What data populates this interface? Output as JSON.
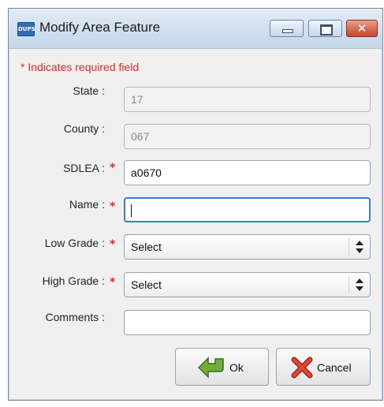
{
  "window": {
    "title": "Modify Area Feature",
    "app_icon_text": "DUPS"
  },
  "form": {
    "required_note": "* Indicates required field",
    "fields": {
      "state": {
        "label": "State :",
        "value": "17"
      },
      "county": {
        "label": "County :",
        "value": "067"
      },
      "sdlea": {
        "label": "SDLEA :",
        "value": "a0670",
        "required": true
      },
      "name": {
        "label": "Name :",
        "value": "",
        "required": true
      },
      "low_grade": {
        "label": "Low Grade :",
        "value": "Select",
        "required": true
      },
      "high_grade": {
        "label": "High Grade :",
        "value": "Select",
        "required": true
      },
      "comments": {
        "label": "Comments :",
        "value": ""
      }
    },
    "required_star": "*"
  },
  "buttons": {
    "ok": "Ok",
    "cancel": "Cancel"
  },
  "colors": {
    "required": "#e02a2a",
    "focus_border": "#3a7bd5",
    "titlebar": "#d1dfef",
    "close_button": "#c5442b"
  }
}
